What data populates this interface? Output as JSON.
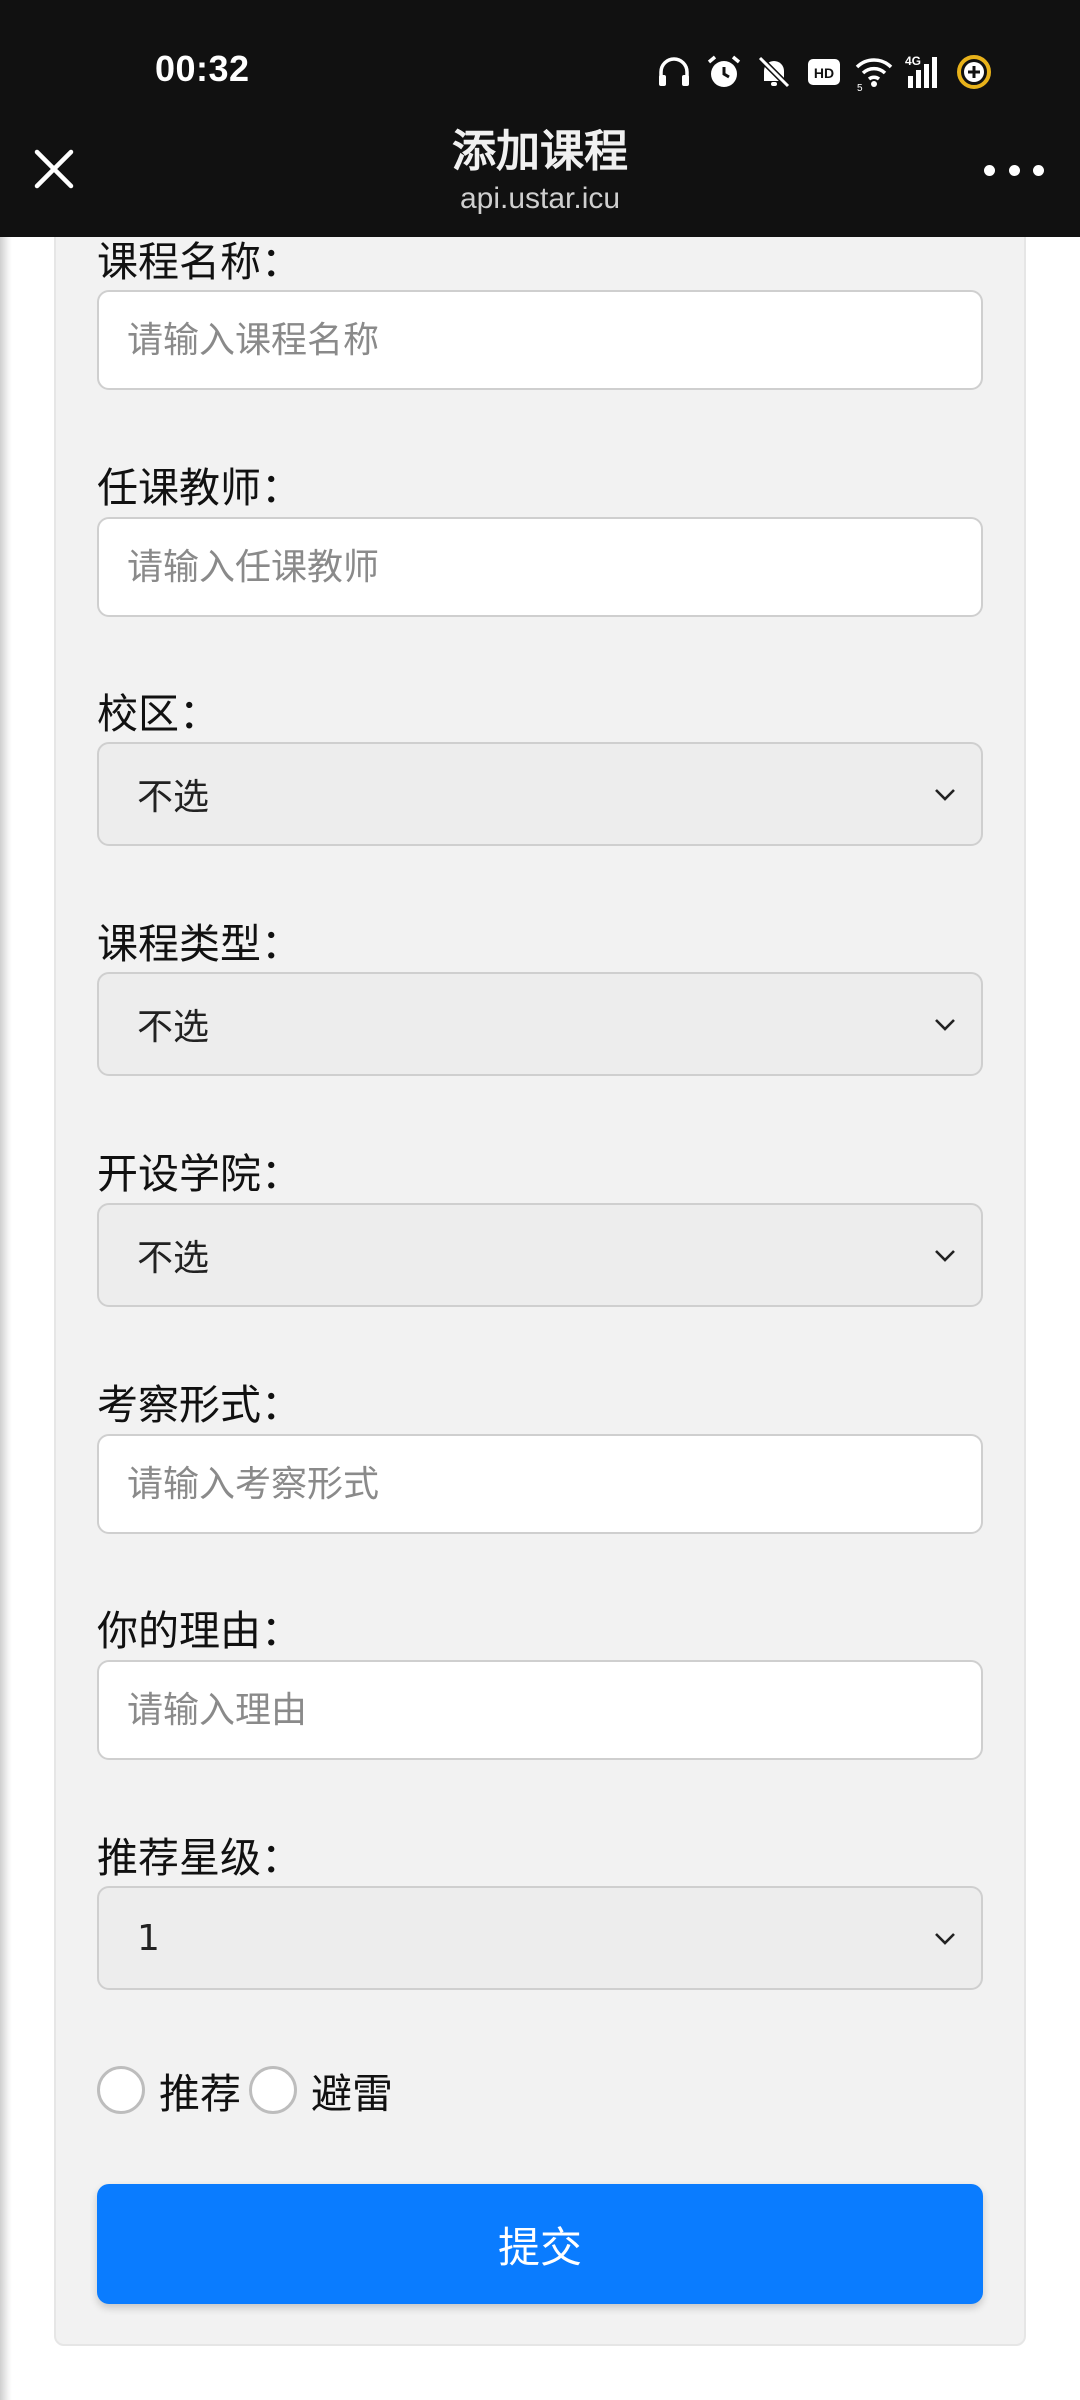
{
  "status_bar": {
    "time": "00:32",
    "icons": [
      "headphones-icon",
      "alarm-icon",
      "bell-off-icon",
      "hd-icon",
      "wifi-icon",
      "signal-4g-icon",
      "battery-charging-icon"
    ],
    "hd_label": "HD",
    "network_label": "4G",
    "wifi_badge": "5"
  },
  "title_bar": {
    "title": "添加课程",
    "host": "api.ustar.icu"
  },
  "form": {
    "course_name": {
      "label": "课程名称：",
      "placeholder": "请输入课程名称"
    },
    "teacher": {
      "label": "任课教师：",
      "placeholder": "请输入任课教师"
    },
    "campus": {
      "label": "校区：",
      "value": "不选"
    },
    "course_type": {
      "label": "课程类型：",
      "value": "不选"
    },
    "college": {
      "label": "开设学院：",
      "value": "不选"
    },
    "exam_form": {
      "label": "考察形式：",
      "placeholder": "请输入考察形式"
    },
    "reason": {
      "label": "你的理由：",
      "placeholder": "请输入理由"
    },
    "rating": {
      "label": "推荐星级：",
      "value": "1"
    },
    "radio_recommend": "推荐",
    "radio_avoid": "避雷",
    "submit_label": "提交"
  },
  "colors": {
    "status_bar_bg": "#111111",
    "submit_bg": "#0a7cff",
    "card_bg": "#f2f2f2",
    "battery_ring": "#e8b21a"
  }
}
